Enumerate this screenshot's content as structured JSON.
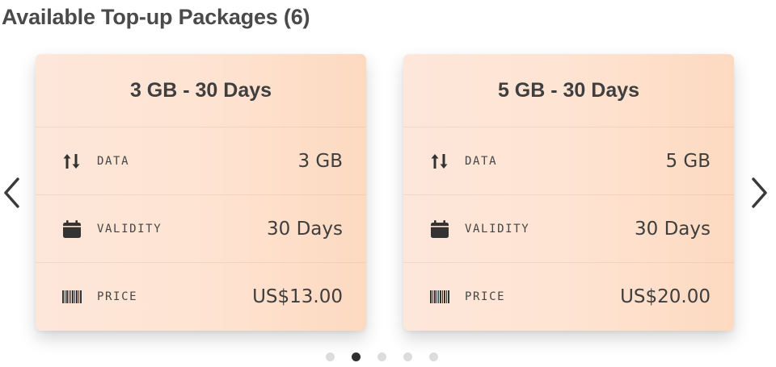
{
  "section": {
    "title": "Available Top-up Packages (6)"
  },
  "cards": [
    {
      "title": "3 GB - 30 Days",
      "rows": [
        {
          "icon": "data-transfer-icon",
          "label": "DATA",
          "value": "3 GB"
        },
        {
          "icon": "calendar-icon",
          "label": "VALIDITY",
          "value": "30 Days"
        },
        {
          "icon": "barcode-icon",
          "label": "PRICE",
          "value": "US$13.00"
        }
      ]
    },
    {
      "title": "5 GB - 30 Days",
      "rows": [
        {
          "icon": "data-transfer-icon",
          "label": "DATA",
          "value": "5 GB"
        },
        {
          "icon": "calendar-icon",
          "label": "VALIDITY",
          "value": "30 Days"
        },
        {
          "icon": "barcode-icon",
          "label": "PRICE",
          "value": "US$20.00"
        }
      ]
    }
  ],
  "carousel": {
    "page_count": 5,
    "active_index": 1,
    "prev_icon": "chevron-left-icon",
    "next_icon": "chevron-right-icon"
  },
  "colors": {
    "card_bg": "#fee3d1",
    "active_dot": "#2e2e2e",
    "inactive_dot": "#dcdcdc"
  }
}
